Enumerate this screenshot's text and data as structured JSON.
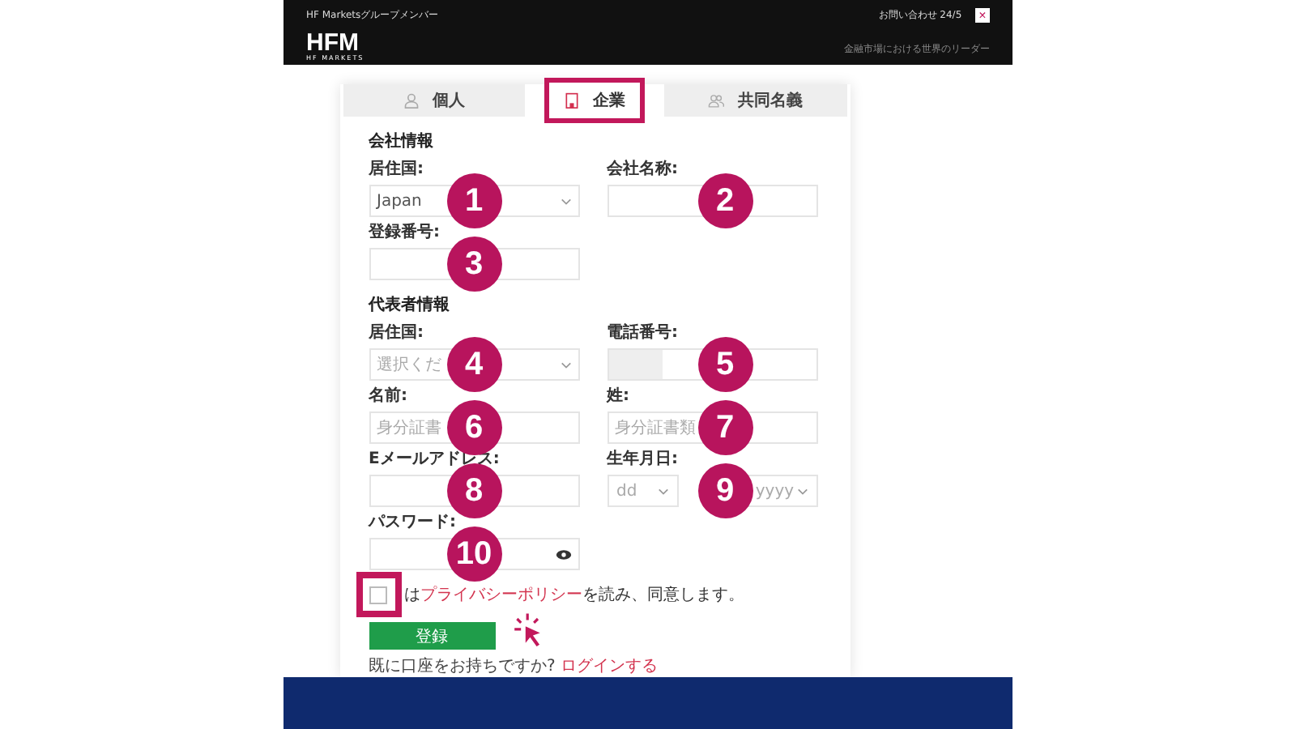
{
  "header": {
    "group_label": "HF Marketsグループメンバー",
    "contact": "お問い合わせ 24/5",
    "close": "×",
    "logo": "HFM",
    "logo_sub": "HF MARKETS",
    "tagline": "金融市場における世界のリーダー"
  },
  "tabs": [
    {
      "label": "個人",
      "selected": false,
      "highlighted": false
    },
    {
      "label": "企業",
      "selected": true,
      "highlighted": true
    },
    {
      "label": "共同名義",
      "selected": false,
      "highlighted": false
    }
  ],
  "sections": [
    {
      "title": "会社情報",
      "rows": [
        [
          {
            "label": "居住国:",
            "kind": "select",
            "value": "Japan",
            "marker": "1"
          },
          {
            "label": "会社名称:",
            "kind": "input",
            "marker": "2"
          }
        ],
        [
          {
            "label": "登録番号:",
            "kind": "input",
            "marker": "3"
          }
        ]
      ]
    },
    {
      "title": "代表者情報",
      "rows": [
        [
          {
            "label": "居住国:",
            "kind": "select",
            "placeholder": "選択くだ",
            "marker": "4"
          },
          {
            "label": "電話番号:",
            "kind": "phone",
            "marker": "5"
          }
        ],
        [
          {
            "label": "名前:",
            "kind": "input",
            "placeholder": "身分証書",
            "marker": "6"
          },
          {
            "label": "姓:",
            "kind": "input",
            "placeholder": "身分証書類",
            "marker": "7"
          }
        ],
        [
          {
            "label": "Eメールアドレス:",
            "kind": "input",
            "marker": "8"
          },
          {
            "label": "生年月日:",
            "kind": "date",
            "day": "dd",
            "year": "yyyy",
            "marker": "9"
          }
        ],
        [
          {
            "label": "パスワード:",
            "kind": "password",
            "marker": "10"
          }
        ]
      ]
    }
  ],
  "agree": {
    "checked": false,
    "highlighted": true,
    "before": "は",
    "link": "プライバシーポリシー",
    "after": "を読み、同意します。"
  },
  "submit": "登録",
  "login": {
    "prompt": "既に口座をお持ちですか?",
    "link": "ログインする"
  }
}
